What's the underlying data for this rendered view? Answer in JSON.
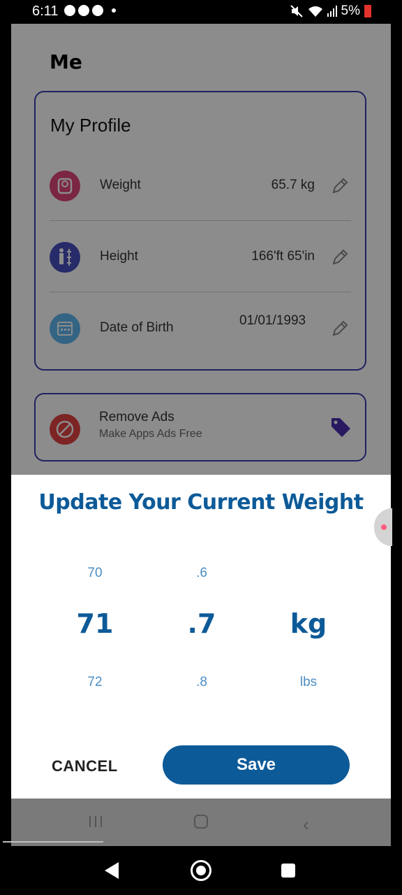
{
  "status_bar": {
    "time": "6:11",
    "battery": "5%"
  },
  "page": {
    "title": "Me"
  },
  "profile": {
    "title": "My Profile",
    "rows": [
      {
        "label": "Weight",
        "value": "65.7 kg"
      },
      {
        "label": "Height",
        "value": "166'ft 65'in"
      },
      {
        "label": "Date of Birth",
        "value": "01/01/1993"
      }
    ]
  },
  "ads": {
    "title": "Remove Ads",
    "subtitle": "Make Apps Ads Free"
  },
  "dialog": {
    "title": "Update Your Current Weight",
    "picker": {
      "whole": {
        "prev": "70",
        "current": "71",
        "next": "72"
      },
      "decimal": {
        "prev": ".6",
        "current": ".7",
        "next": ".8"
      },
      "unit": {
        "prev": "",
        "current": "kg",
        "next": "lbs"
      }
    },
    "cancel_label": "CANCEL",
    "save_label": "Save"
  },
  "colors": {
    "accent": "#0d5a98",
    "card_border": "#3b3fb0",
    "weight_icon": "#e0467a",
    "height_icon": "#4a4fbf",
    "dob_icon": "#5fb6ef",
    "ads_icon": "#e34343"
  },
  "icons": [
    "weight-scale-icon",
    "height-icon",
    "calendar-icon",
    "pencil-icon",
    "no-ads-icon",
    "tag-icon"
  ]
}
